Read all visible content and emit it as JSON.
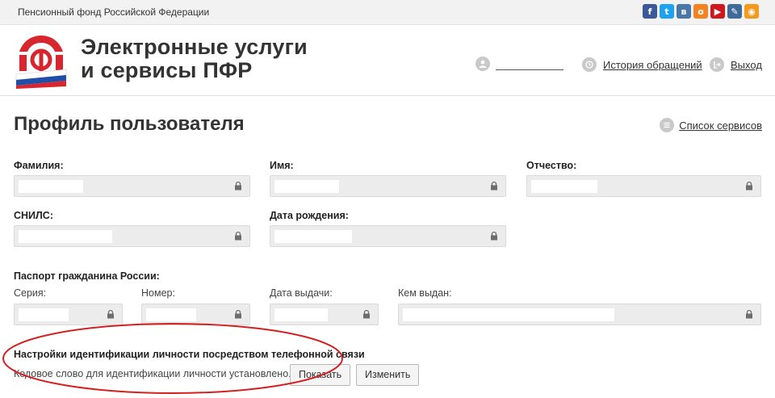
{
  "topbar": {
    "org_name": "Пенсионный фонд Российской Федерации",
    "social": [
      {
        "name": "facebook-icon",
        "glyph": "f",
        "color": "#3b5998"
      },
      {
        "name": "twitter-icon",
        "glyph": "t",
        "color": "#1da1f2"
      },
      {
        "name": "vk-icon",
        "glyph": "в",
        "color": "#4a76a8"
      },
      {
        "name": "odnoklassniki-icon",
        "glyph": "о",
        "color": "#f58220"
      },
      {
        "name": "youtube-icon",
        "glyph": "▶",
        "color": "#cc181e"
      },
      {
        "name": "livejournal-icon",
        "glyph": "✎",
        "color": "#3f6b9b"
      },
      {
        "name": "rss-icon",
        "glyph": "◉",
        "color": "#f39a1d"
      }
    ]
  },
  "header": {
    "title_line1": "Электронные услуги",
    "title_line2": "и сервисы ПФР",
    "history_link": "История обращений",
    "logout_link": "Выход"
  },
  "page": {
    "title": "Профиль пользователя",
    "services_link": "Список сервисов"
  },
  "profile": {
    "surname_label": "Фамилия:",
    "name_label": "Имя:",
    "patronymic_label": "Отчество:",
    "snils_label": "СНИЛС:",
    "birthdate_label": "Дата рождения:",
    "passport_heading": "Паспорт гражданина России:",
    "series_label": "Серия:",
    "number_label": "Номер:",
    "issue_date_label": "Дата выдачи:",
    "issued_by_label": "Кем выдан:"
  },
  "identification": {
    "title": "Настройки идентификации личности посредством телефонной связи",
    "status": "Кодовое слово для идентификации личности установлено.",
    "show_button": "Показать",
    "change_button": "Изменить"
  },
  "colors": {
    "oval": "#d42020",
    "logo_red": "#d8262e",
    "flag_blue": "#1f4fa8"
  }
}
